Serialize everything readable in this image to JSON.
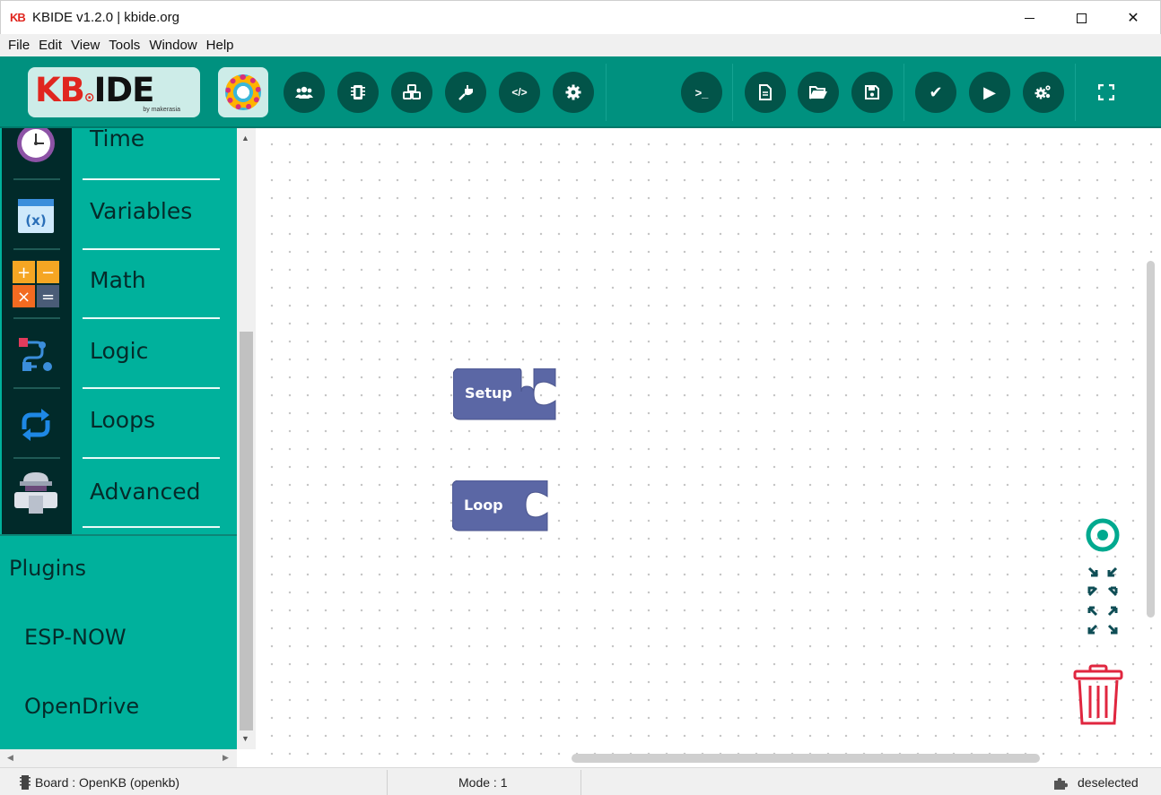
{
  "window": {
    "logo_text": "KB",
    "title": "KBIDE v1.2.0 | kbide.org",
    "minimize_icon": "minimize-icon",
    "maximize_icon": "maximize-icon",
    "close_glyph": "✕"
  },
  "menu": [
    "File",
    "Edit",
    "View",
    "Tools",
    "Window",
    "Help"
  ],
  "toolbar": {
    "logo_kb": "KB",
    "logo_ide": "IDE",
    "logo_sub": "by makerasia",
    "left_buttons": [
      {
        "name": "users-icon",
        "glyph": "👥"
      },
      {
        "name": "chip-icon",
        "glyph": "▣"
      },
      {
        "name": "cubes-icon",
        "glyph": "⬢"
      },
      {
        "name": "plug-icon",
        "glyph": "⚡"
      },
      {
        "name": "code-icon",
        "glyph": "</>"
      },
      {
        "name": "gear-icon",
        "glyph": "⚙"
      }
    ],
    "right_buttons": [
      {
        "name": "terminal-icon",
        "glyph": ">_"
      },
      {
        "name": "new-file-icon",
        "glyph": "🗋"
      },
      {
        "name": "open-folder-icon",
        "glyph": "📂"
      },
      {
        "name": "save-icon",
        "glyph": "💾"
      },
      {
        "name": "check-icon",
        "glyph": "✔"
      },
      {
        "name": "play-icon",
        "glyph": "▶"
      },
      {
        "name": "cogs-icon",
        "glyph": "⚙"
      },
      {
        "name": "fullscreen-icon",
        "glyph": "⛶"
      }
    ]
  },
  "categories": [
    {
      "label": "Time",
      "icon": "clock-icon"
    },
    {
      "label": "Variables",
      "icon": "variables-icon"
    },
    {
      "label": "Math",
      "icon": "math-icon"
    },
    {
      "label": "Logic",
      "icon": "logic-icon"
    },
    {
      "label": "Loops",
      "icon": "loops-icon"
    },
    {
      "label": "Advanced",
      "icon": "advanced-icon"
    }
  ],
  "plugins": {
    "title": "Plugins",
    "items": [
      "ESP-NOW",
      "OpenDrive"
    ]
  },
  "workspace": {
    "blocks": [
      {
        "label": "Setup",
        "color": "#5b67a5"
      },
      {
        "label": "Loop",
        "color": "#5b67a5"
      }
    ],
    "controls": [
      "recenter-icon",
      "zoom-fit-icon",
      "trash-icon"
    ]
  },
  "status": {
    "board": "Board : OpenKB (openkb)",
    "mode": "Mode : 1",
    "selection": "deselected"
  },
  "colors": {
    "toolbar_bg": "#00917f",
    "panel_bg": "#00b19c",
    "button_bg": "#025449",
    "block_color": "#5b67a5",
    "trash_color": "#e0263f"
  }
}
